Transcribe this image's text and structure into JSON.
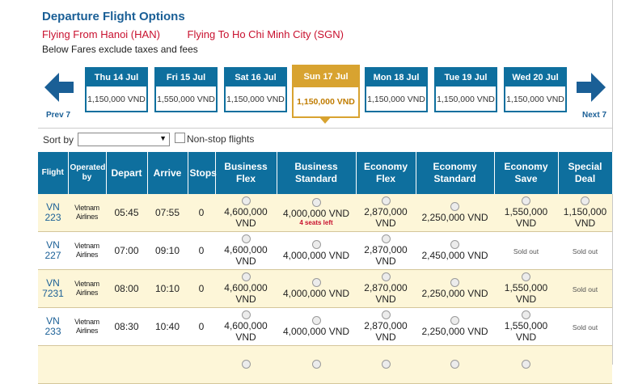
{
  "header": {
    "title": "Departure Flight Options",
    "flying_from": "Flying From Hanoi (HAN)",
    "flying_to": "Flying To Ho Chi Minh City (SGN)",
    "fare_note": "Below Fares exclude taxes and fees"
  },
  "date_nav": {
    "prev_label": "Prev 7",
    "next_label": "Next 7",
    "dates": [
      {
        "label": "Thu 14 Jul",
        "price": "1,150,000 VND"
      },
      {
        "label": "Fri 15 Jul",
        "price": "1,550,000 VND"
      },
      {
        "label": "Sat 16 Jul",
        "price": "1,150,000 VND"
      },
      {
        "label": "Sun 17 Jul",
        "price": "1,150,000 VND",
        "active": true
      },
      {
        "label": "Mon 18 Jul",
        "price": "1,150,000 VND"
      },
      {
        "label": "Tue 19 Jul",
        "price": "1,150,000 VND"
      },
      {
        "label": "Wed 20 Jul",
        "price": "1,150,000 VND"
      }
    ]
  },
  "sort": {
    "label": "Sort by",
    "value": "",
    "nonstop_label": "Non-stop flights"
  },
  "table": {
    "headers": {
      "flight": "Flight",
      "operated_by": "Operated by",
      "depart": "Depart",
      "arrive": "Arrive",
      "stops": "Stops",
      "business_flex": "Business Flex",
      "business_standard": "Business Standard",
      "economy_flex": "Economy Flex",
      "economy_standard": "Economy Standard",
      "economy_save": "Economy Save",
      "special_deal": "Special Deal"
    },
    "rows": [
      {
        "flight": "VN 223",
        "operator": "Vietnam Airlines",
        "depart": "05:45",
        "arrive": "07:55",
        "stops": "0",
        "fares": [
          "4,600,000 VND",
          "4,000,000 VND",
          "2,870,000 VND",
          "2,250,000 VND",
          "1,550,000 VND",
          "1,150,000 VND"
        ],
        "seats_note": "4 seats left"
      },
      {
        "flight": "VN 227",
        "operator": "Vietnam Airlines",
        "depart": "07:00",
        "arrive": "09:10",
        "stops": "0",
        "fares": [
          "4,600,000 VND",
          "4,000,000 VND",
          "2,870,000 VND",
          "2,450,000 VND",
          "Sold out",
          "Sold out"
        ]
      },
      {
        "flight": "VN 7231",
        "operator": "Vietnam Airlines",
        "depart": "08:00",
        "arrive": "10:10",
        "stops": "0",
        "fares": [
          "4,600,000 VND",
          "4,000,000 VND",
          "2,870,000 VND",
          "2,250,000 VND",
          "1,550,000 VND",
          "Sold out"
        ]
      },
      {
        "flight": "VN 233",
        "operator": "Vietnam Airlines",
        "depart": "08:30",
        "arrive": "10:40",
        "stops": "0",
        "fares": [
          "4,600,000 VND",
          "4,000,000 VND",
          "2,870,000 VND",
          "2,250,000 VND",
          "1,550,000 VND",
          "Sold out"
        ]
      }
    ]
  },
  "colors": {
    "header_blue": "#0e6f9e",
    "active_gold": "#d8a330",
    "route_red": "#c8102e",
    "row_yellow": "#fdf6d8"
  },
  "icons": {
    "prev": "arrow-left-icon",
    "next": "arrow-right-icon"
  }
}
